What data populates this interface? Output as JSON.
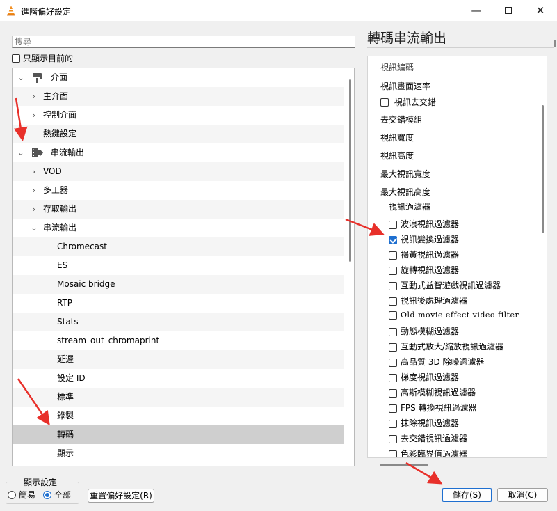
{
  "window": {
    "title": "進階偏好設定"
  },
  "search": {
    "placeholder": "搜尋"
  },
  "only_used": {
    "label": "只顯示目前的"
  },
  "tree": {
    "items": [
      {
        "label": "介面",
        "expanded": true,
        "icon": "interface-icon"
      },
      {
        "label": "主介面"
      },
      {
        "label": "控制介面"
      },
      {
        "label": "熱鍵設定"
      },
      {
        "label": "串流輸出",
        "expanded": true,
        "icon": "stream-output-icon"
      },
      {
        "label": "VOD"
      },
      {
        "label": "多工器"
      },
      {
        "label": "存取輸出"
      },
      {
        "label": "串流輸出",
        "expanded": true
      },
      {
        "label": "Chromecast"
      },
      {
        "label": "ES"
      },
      {
        "label": "Mosaic bridge"
      },
      {
        "label": "RTP"
      },
      {
        "label": "Stats"
      },
      {
        "label": "stream_out_chromaprint"
      },
      {
        "label": "延遲"
      },
      {
        "label": "設定 ID"
      },
      {
        "label": "標準"
      },
      {
        "label": "錄製"
      },
      {
        "label": "轉碼",
        "selected": true
      },
      {
        "label": "顯示"
      }
    ]
  },
  "panel": {
    "title": "轉碼串流輸出",
    "top_partial": "視訊編碼",
    "items": [
      {
        "label": "視訊畫面速率"
      },
      {
        "label": "視訊去交錯",
        "checkbox": true,
        "checked": false
      },
      {
        "label": "去交錯模組"
      },
      {
        "label": "視訊寬度"
      },
      {
        "label": "視訊高度"
      },
      {
        "label": "最大視訊寬度"
      },
      {
        "label": "最大視訊高度"
      }
    ],
    "group_title": "視訊過濾器",
    "filters": [
      {
        "label": "波浪視訊過濾器",
        "checked": false
      },
      {
        "label": "視訊變換過濾器",
        "checked": true
      },
      {
        "label": "褐黃視訊過濾器",
        "checked": false
      },
      {
        "label": "旋轉視訊過濾器",
        "checked": false
      },
      {
        "label": "互動式益智遊戲視訊過濾器",
        "checked": false
      },
      {
        "label": "視訊後處理過濾器",
        "checked": false
      },
      {
        "label": "Old movie effect video filter",
        "checked": false
      },
      {
        "label": "動態模糊過濾器",
        "checked": false
      },
      {
        "label": "互動式放大/縮放視訊過濾器",
        "checked": false
      },
      {
        "label": "高品質 3D 除噪過濾器",
        "checked": false
      },
      {
        "label": "梯度視訊過濾器",
        "checked": false
      },
      {
        "label": "高斯模糊視訊過濾器",
        "checked": false
      },
      {
        "label": "FPS 轉換視訊過濾器",
        "checked": false
      },
      {
        "label": "抹除視訊過濾器",
        "checked": false
      },
      {
        "label": "去交錯視訊過濾器",
        "checked": false
      },
      {
        "label": "色彩臨界值過濾器",
        "checked": false
      }
    ]
  },
  "display_settings": {
    "title": "顯示設定",
    "options": [
      {
        "label": "簡易",
        "selected": false
      },
      {
        "label": "全部",
        "selected": true
      }
    ]
  },
  "buttons": {
    "reset": "重置偏好設定(R)",
    "save": "儲存(S)",
    "cancel": "取消(C)"
  },
  "colors": {
    "accent": "#1e6fd0",
    "annotation_arrow": "#e8302a",
    "selection": "#cfcfcf"
  }
}
